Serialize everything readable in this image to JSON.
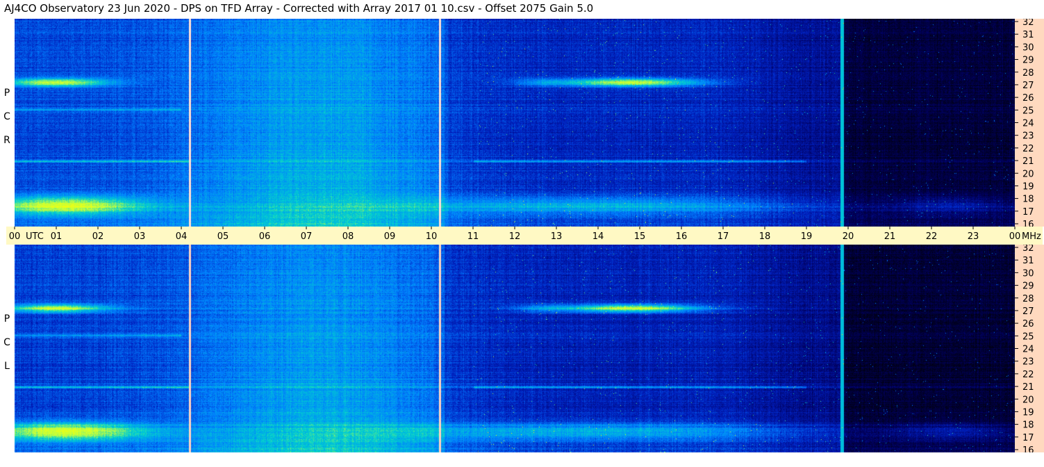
{
  "title": "AJ4CO Observatory  23 Jun 2020  -  DPS on TFD Array  -  Corrected with Array 2017 01 10.csv  -  Offset 2075  Gain 5.0",
  "chart_data": {
    "type": "heatmap",
    "x_unit": "UTC",
    "y_unit": "MHz",
    "x_ticks": [
      "00",
      "01",
      "02",
      "03",
      "04",
      "05",
      "06",
      "07",
      "08",
      "09",
      "10",
      "11",
      "12",
      "13",
      "14",
      "15",
      "16",
      "17",
      "18",
      "19",
      "20",
      "21",
      "22",
      "23",
      "00"
    ],
    "y_ticks": [
      "32",
      "31",
      "30",
      "29",
      "28",
      "27",
      "26",
      "25",
      "24",
      "23",
      "22",
      "21",
      "20",
      "19",
      "18",
      "17",
      "16"
    ],
    "xlim": [
      0,
      24
    ],
    "ylim": [
      16,
      32
    ],
    "panels": [
      {
        "name": "R C P",
        "letters": [
          "P",
          "C",
          "R"
        ]
      },
      {
        "name": "L C P",
        "letters": [
          "P",
          "C",
          "L"
        ]
      }
    ],
    "colormap": [
      "#000010",
      "#000060",
      "#0020c0",
      "#0080ff",
      "#00d0d0",
      "#c0ff40",
      "#ffff00",
      "#ff4000",
      "#ffffff"
    ],
    "vertical_markers_hours": [
      4.2,
      10.2,
      19.85
    ],
    "emission_bands_mhz": [
      27.1,
      17.6,
      21.0,
      25.0
    ]
  }
}
